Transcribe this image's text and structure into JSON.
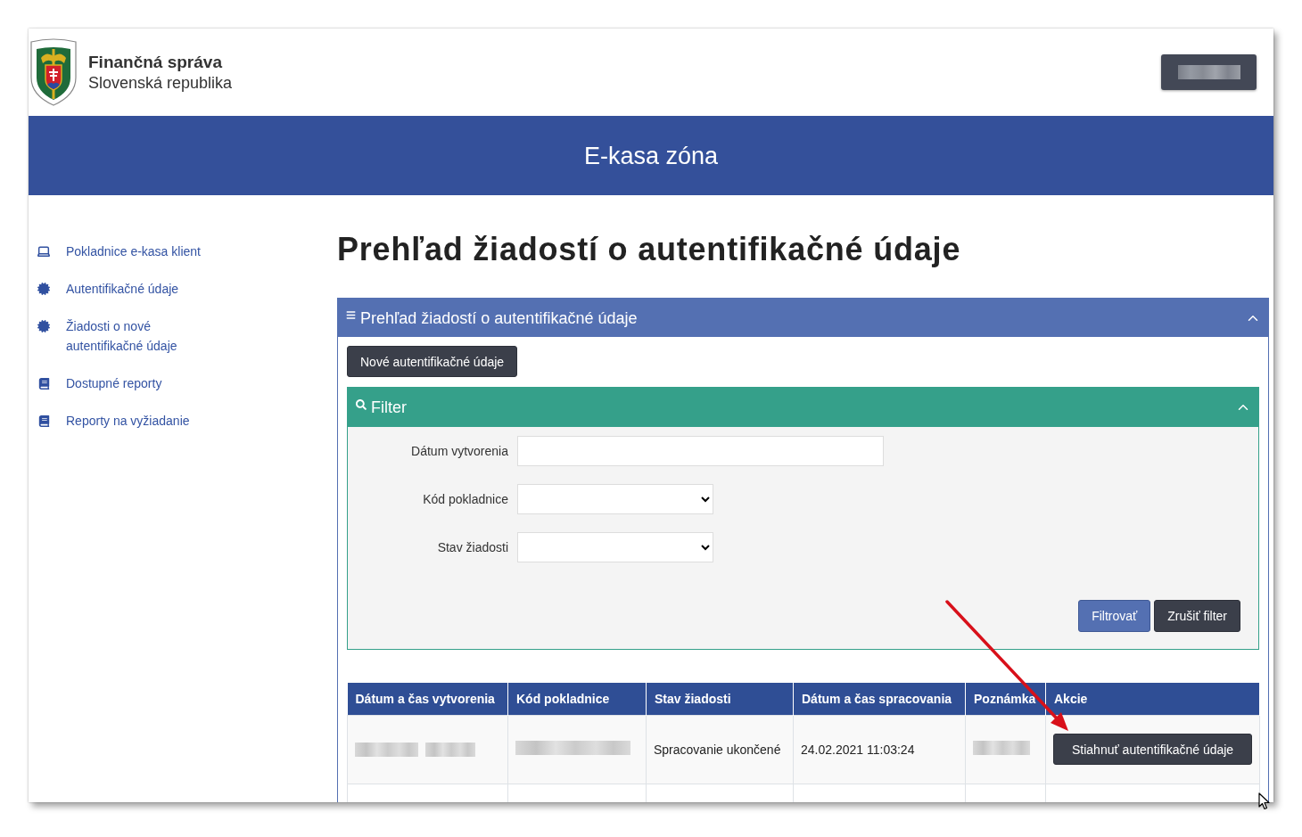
{
  "header": {
    "brand": {
      "title": "Finančná správa",
      "subtitle": "Slovenská republika"
    },
    "account_button": {
      "redacted": true
    }
  },
  "banner": {
    "title": "E-kasa zóna"
  },
  "sidebar": {
    "items": [
      {
        "kind": "terminal",
        "label": "Pokladnice e-kasa klient"
      },
      {
        "kind": "credentials",
        "label": "Autentifikačné údaje"
      },
      {
        "kind": "credentials",
        "label": "Žiadosti o nové autentifikačné údaje"
      },
      {
        "kind": "report",
        "label": "Dostupné reporty"
      },
      {
        "kind": "report",
        "label": "Reporty na vyžiadanie"
      }
    ]
  },
  "page_title": "Prehľad žiadostí o autentifikačné údaje",
  "panel": {
    "title": "Prehľad žiadostí o autentifikačné údaje",
    "expanded": true,
    "new_button": "Nové autentifikačné údaje",
    "filter": {
      "title": "Filter",
      "expanded": true,
      "fields": [
        {
          "kind": "text",
          "label": "Dátum vytvorenia"
        },
        {
          "kind": "select",
          "label": "Kód pokladnice"
        },
        {
          "kind": "select",
          "label": "Stav žiadosti"
        }
      ],
      "buttons": [
        {
          "kind": "primary",
          "label": "Filtrovať"
        },
        {
          "kind": "secondary",
          "label": "Zrušiť filter"
        }
      ]
    },
    "table": {
      "columns": [
        "Dátum a čas vytvorenia",
        "Kód pokladnice",
        "Stav žiadosti",
        "Dátum a čas spracovania",
        "Poznámka",
        "Akcie"
      ],
      "rows": [
        {
          "cells": [
            {
              "kind": "redacted_datetime"
            },
            {
              "kind": "redacted"
            },
            {
              "kind": "text",
              "text": "Spracovanie ukončené"
            },
            {
              "kind": "text",
              "text": "24.02.2021 11:03:24"
            },
            {
              "kind": "redacted"
            },
            {
              "kind": "button",
              "text": "Stiahnuť autentifikačné údaje"
            }
          ]
        }
      ]
    }
  }
}
